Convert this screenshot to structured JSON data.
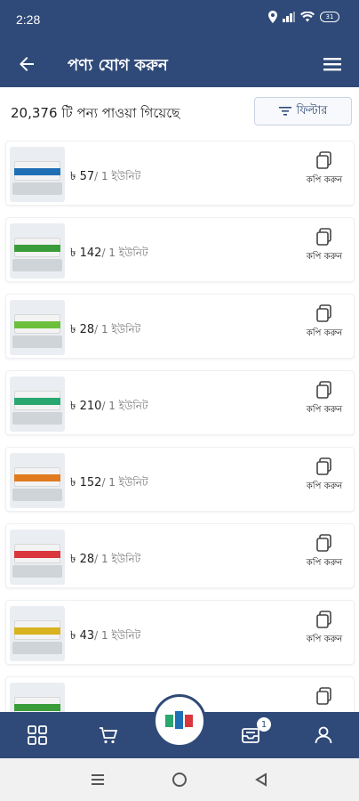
{
  "status_bar": {
    "time": "2:28",
    "battery": "31"
  },
  "app_bar": {
    "title": "পণ্য যোগ করুন"
  },
  "results": {
    "count_text": "20,376 টি পন্য পাওয়া গিয়েছে",
    "filter_label": "ফিল্টার"
  },
  "products": [
    {
      "currency": "৳",
      "price": "57",
      "unit": "/ 1 ইউনিট",
      "copy_label": "কপি করুন",
      "color": "#1f6fb5"
    },
    {
      "currency": "৳",
      "price": "142",
      "unit": "/ 1 ইউনিট",
      "copy_label": "কপি করুন",
      "color": "#3a9c3a"
    },
    {
      "currency": "৳",
      "price": "28",
      "unit": "/ 1 ইউনিট",
      "copy_label": "কপি করুন",
      "color": "#6cbf3c"
    },
    {
      "currency": "৳",
      "price": "210",
      "unit": "/ 1 ইউনিট",
      "copy_label": "কপি করুন",
      "color": "#2aa66f"
    },
    {
      "currency": "৳",
      "price": "152",
      "unit": "/ 1 ইউনিট",
      "copy_label": "কপি করুন",
      "color": "#e07b1f"
    },
    {
      "currency": "৳",
      "price": "28",
      "unit": "/ 1 ইউনিট",
      "copy_label": "কপি করুন",
      "color": "#d9363e"
    },
    {
      "currency": "৳",
      "price": "43",
      "unit": "/ 1 ইউনিট",
      "copy_label": "কপি করুন",
      "color": "#d8b21f"
    },
    {
      "currency": "",
      "price": "",
      "unit": "",
      "copy_label": "",
      "color": "#3a9c3a"
    }
  ],
  "bottom_nav": {
    "cart_badge": "1"
  },
  "colors": {
    "primary": "#2f4a78",
    "background": "#ffffff"
  }
}
